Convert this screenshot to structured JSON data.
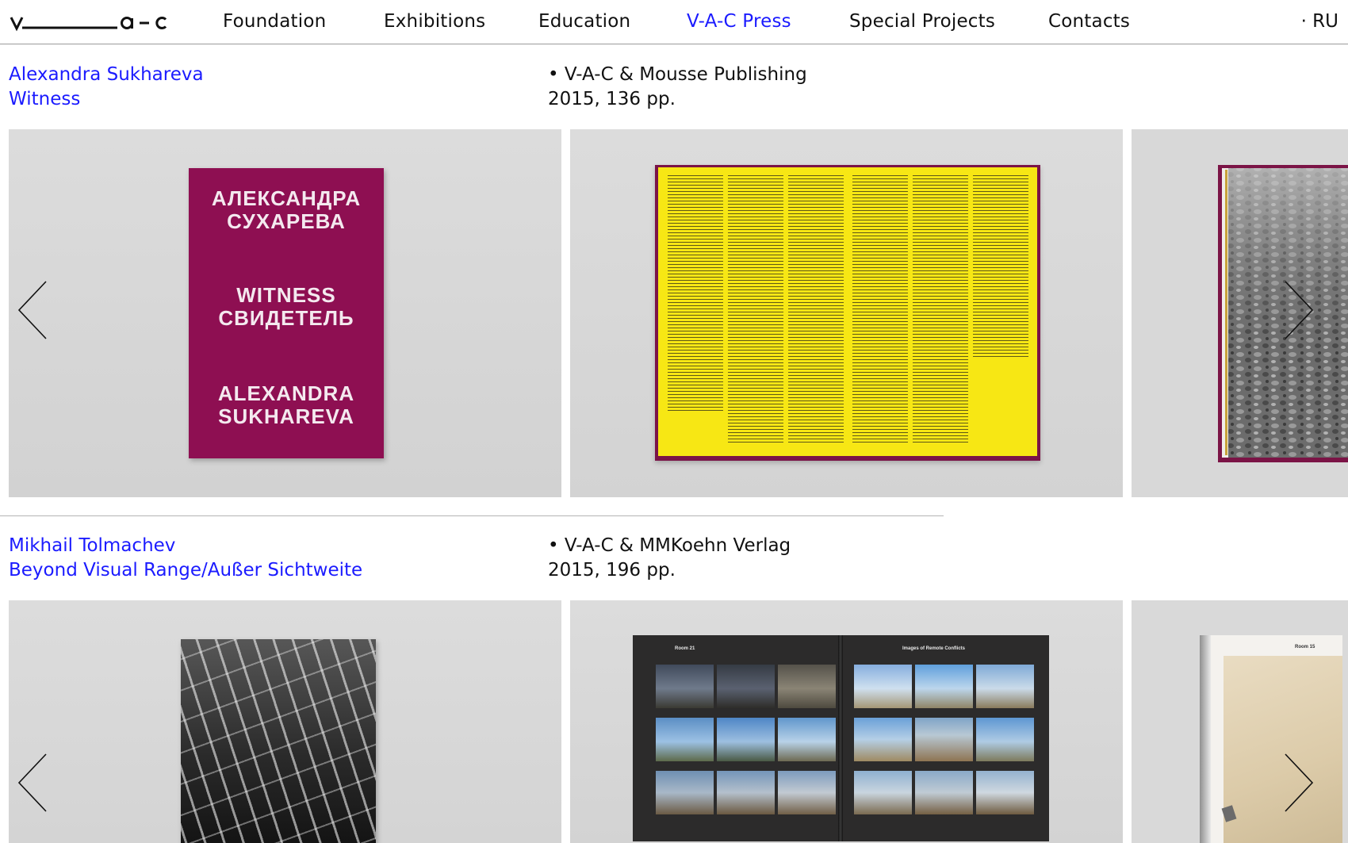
{
  "header": {
    "nav": [
      {
        "label": "Foundation",
        "active": false
      },
      {
        "label": "Exhibitions",
        "active": false
      },
      {
        "label": "Education",
        "active": false
      },
      {
        "label": "V-A-C Press",
        "active": true
      },
      {
        "label": "Special Projects",
        "active": false
      },
      {
        "label": "Contacts",
        "active": false
      }
    ],
    "language": "· RU"
  },
  "colors": {
    "link": "#1b1bff",
    "cover_magenta": "#8e0f52",
    "spread_yellow": "#f7e714"
  },
  "entries": [
    {
      "author": "Alexandra Sukhareva",
      "title": "Witness",
      "publisher": "• V-A-C & Mousse Publishing",
      "details": "2015, 136 pp.",
      "cover_text": {
        "line1": "АЛЕКСАНДРА",
        "line2": "СУХАРЕВА",
        "line3": "WITNESS",
        "line4": "СВИДЕТЕЛЬ",
        "line5": "ALEXANDRA",
        "line6": "SUKHAREVA"
      }
    },
    {
      "author": "Mikhail Tolmachev",
      "title": "Beyond Visual Range/Außer Sichtweite",
      "publisher": "• V-A-C & MMKoehn Verlag",
      "details": "2015, 196 pp.",
      "spread_labels": {
        "left": "Room 21",
        "right": "Images of Remote Conflicts",
        "third": "Room 15"
      }
    }
  ],
  "icons": {
    "prev": "chevron-left-icon",
    "next": "chevron-right-icon"
  }
}
